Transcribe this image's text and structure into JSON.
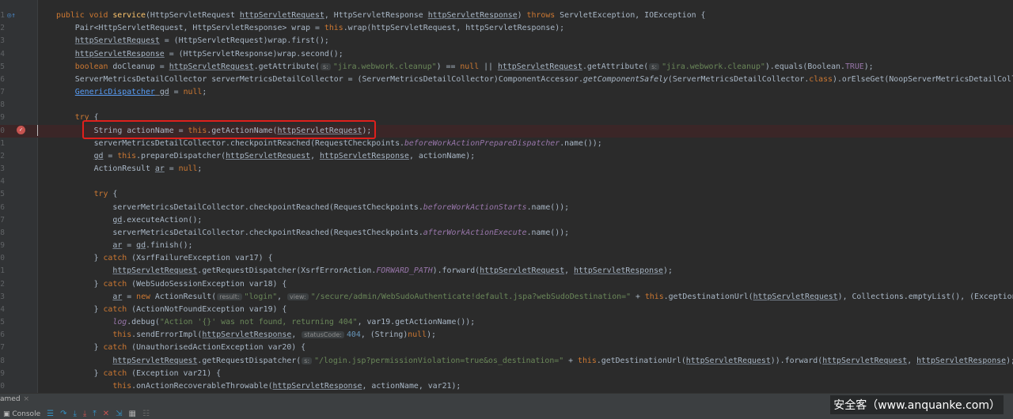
{
  "code": {
    "lines": [
      {
        "num": "1",
        "indent": 0,
        "t": [
          [
            "kw",
            "public void "
          ],
          [
            "m",
            "service"
          ],
          [
            "",
            "(HttpServletRequest "
          ],
          [
            "u",
            "httpServletRequest"
          ],
          [
            "",
            ", HttpServletResponse "
          ],
          [
            "u",
            "httpServletResponse"
          ],
          [
            "",
            ") "
          ],
          [
            "kw",
            "throws "
          ],
          [
            "",
            "ServletException, IOException {"
          ]
        ]
      },
      {
        "num": "2",
        "indent": 1,
        "t": [
          [
            "",
            "Pair<HttpServletRequest, HttpServletResponse> wrap = "
          ],
          [
            "kw",
            "this"
          ],
          [
            "",
            ".wrap(httpServletRequest, httpServletResponse);"
          ]
        ]
      },
      {
        "num": "3",
        "indent": 1,
        "t": [
          [
            "u",
            "httpServletRequest"
          ],
          [
            "",
            " = (HttpServletRequest)wrap.first();"
          ]
        ]
      },
      {
        "num": "4",
        "indent": 1,
        "t": [
          [
            "u",
            "httpServletResponse"
          ],
          [
            "",
            " = (HttpServletResponse)wrap.second();"
          ]
        ]
      },
      {
        "num": "5",
        "indent": 1,
        "t": [
          [
            "kw",
            "boolean "
          ],
          [
            "",
            "doCleanup = "
          ],
          [
            "u",
            "httpServletRequest"
          ],
          [
            "",
            ".getAttribute("
          ],
          [
            "h",
            "s:"
          ],
          [
            "s",
            "\"jira.webwork.cleanup\""
          ],
          [
            "",
            ") == "
          ],
          [
            "kw",
            "null "
          ],
          [
            "",
            "|| "
          ],
          [
            "u",
            "httpServletRequest"
          ],
          [
            "",
            ".getAttribute("
          ],
          [
            "h",
            "s:"
          ],
          [
            "s",
            "\"jira.webwork.cleanup\""
          ],
          [
            "",
            ").equals(Boolean."
          ],
          [
            "f",
            "TRUE"
          ],
          [
            "",
            ");"
          ]
        ]
      },
      {
        "num": "6",
        "indent": 1,
        "t": [
          [
            "",
            "ServerMetricsDetailCollector serverMetricsDetailCollector = (ServerMetricsDetailCollector)ComponentAccessor."
          ],
          [
            "it",
            "getComponentSafely"
          ],
          [
            "",
            "(ServerMetricsDetailCollector."
          ],
          [
            "kw",
            "class"
          ],
          [
            "",
            ").orElseGet(NoopServerMetricsDetailCollec"
          ]
        ]
      },
      {
        "num": "7",
        "indent": 1,
        "t": [
          [
            "cls",
            "GenericDispatcher"
          ],
          [
            "",
            ""
          ],
          [
            "u",
            " gd"
          ],
          [
            "",
            " = "
          ],
          [
            "kw",
            "null"
          ],
          [
            "",
            ";"
          ]
        ]
      },
      {
        "num": "8",
        "indent": 0,
        "t": []
      },
      {
        "num": "9",
        "indent": 1,
        "t": [
          [
            "kw",
            "try "
          ],
          [
            "",
            "{"
          ]
        ]
      },
      {
        "num": "0",
        "indent": 2,
        "hl": true,
        "t": [
          [
            "",
            "String actionName = "
          ],
          [
            "kw",
            "this"
          ],
          [
            "",
            ".getActionName("
          ],
          [
            "u",
            "httpServletRequest"
          ],
          [
            "",
            ");"
          ]
        ]
      },
      {
        "num": "1",
        "indent": 2,
        "t": [
          [
            "",
            "serverMetricsDetailCollector.checkpointReached(RequestCheckpoints."
          ],
          [
            "fi",
            "beforeWorkActionPrepareDispatcher"
          ],
          [
            "",
            ".name());"
          ]
        ]
      },
      {
        "num": "2",
        "indent": 2,
        "t": [
          [
            "u",
            "gd"
          ],
          [
            "",
            " = "
          ],
          [
            "kw",
            "this"
          ],
          [
            "",
            ".prepareDispatcher("
          ],
          [
            "u",
            "httpServletRequest"
          ],
          [
            "",
            ", "
          ],
          [
            "u",
            "httpServletResponse"
          ],
          [
            "",
            ", actionName);"
          ]
        ]
      },
      {
        "num": "3",
        "indent": 2,
        "t": [
          [
            "",
            "ActionResult "
          ],
          [
            "u",
            "ar"
          ],
          [
            "",
            " = "
          ],
          [
            "kw",
            "null"
          ],
          [
            "",
            ";"
          ]
        ]
      },
      {
        "num": "4",
        "indent": 0,
        "t": []
      },
      {
        "num": "5",
        "indent": 2,
        "t": [
          [
            "kw",
            "try "
          ],
          [
            "",
            "{"
          ]
        ]
      },
      {
        "num": "6",
        "indent": 3,
        "t": [
          [
            "",
            "serverMetricsDetailCollector.checkpointReached(RequestCheckpoints."
          ],
          [
            "fi",
            "beforeWorkActionStarts"
          ],
          [
            "",
            ".name());"
          ]
        ]
      },
      {
        "num": "7",
        "indent": 3,
        "t": [
          [
            "u",
            "gd"
          ],
          [
            "",
            ".executeAction();"
          ]
        ]
      },
      {
        "num": "8",
        "indent": 3,
        "t": [
          [
            "",
            "serverMetricsDetailCollector.checkpointReached(RequestCheckpoints."
          ],
          [
            "fi",
            "afterWorkActionExecute"
          ],
          [
            "",
            ".name());"
          ]
        ]
      },
      {
        "num": "9",
        "indent": 3,
        "t": [
          [
            "u",
            "ar"
          ],
          [
            "",
            " = "
          ],
          [
            "u",
            "gd"
          ],
          [
            "",
            ".finish();"
          ]
        ]
      },
      {
        "num": "0",
        "indent": 2,
        "t": [
          [
            "",
            "} "
          ],
          [
            "kw",
            "catch "
          ],
          [
            "",
            "(XsrfFailureException var17) {"
          ]
        ]
      },
      {
        "num": "1",
        "indent": 3,
        "t": [
          [
            "u",
            "httpServletRequest"
          ],
          [
            "",
            ".getRequestDispatcher(XsrfErrorAction."
          ],
          [
            "fi",
            "FORWARD_PATH"
          ],
          [
            "",
            ").forward("
          ],
          [
            "u",
            "httpServletRequest"
          ],
          [
            "",
            ", "
          ],
          [
            "u",
            "httpServletResponse"
          ],
          [
            "",
            ");"
          ]
        ]
      },
      {
        "num": "2",
        "indent": 2,
        "t": [
          [
            "",
            "} "
          ],
          [
            "kw",
            "catch "
          ],
          [
            "",
            "(WebSudoSessionException var18) {"
          ]
        ]
      },
      {
        "num": "3",
        "indent": 3,
        "t": [
          [
            "u",
            "ar"
          ],
          [
            "",
            " = "
          ],
          [
            "kw",
            "new "
          ],
          [
            "",
            "ActionResult("
          ],
          [
            "h",
            "result:"
          ],
          [
            "s",
            "\"login\""
          ],
          [
            "",
            ", "
          ],
          [
            "h",
            "view:"
          ],
          [
            "s",
            "\"/secure/admin/WebSudoAuthenticate!default.jspa?webSudoDestination=\""
          ],
          [
            "",
            " + "
          ],
          [
            "kw",
            "this"
          ],
          [
            "",
            ".getDestinationUrl("
          ],
          [
            "u",
            "httpServletRequest"
          ],
          [
            "",
            "), Collections.emptyList(), (Exception)"
          ]
        ]
      },
      {
        "num": "4",
        "indent": 2,
        "t": [
          [
            "",
            "} "
          ],
          [
            "kw",
            "catch "
          ],
          [
            "",
            "(ActionNotFoundException var19) {"
          ]
        ]
      },
      {
        "num": "5",
        "indent": 3,
        "t": [
          [
            "fi",
            "log"
          ],
          [
            "",
            ".debug("
          ],
          [
            "s",
            "\"Action '{}' was not found, returning 404\""
          ],
          [
            "",
            ", var19.getActionName());"
          ]
        ]
      },
      {
        "num": "6",
        "indent": 3,
        "t": [
          [
            "kw",
            "this"
          ],
          [
            "",
            ".sendErrorImpl("
          ],
          [
            "u",
            "httpServletResponse"
          ],
          [
            "",
            ", "
          ],
          [
            "h",
            "statusCode:"
          ],
          [
            "n",
            "404"
          ],
          [
            "",
            ", (String)"
          ],
          [
            "kw",
            "null"
          ],
          [
            "",
            ");"
          ]
        ]
      },
      {
        "num": "7",
        "indent": 2,
        "t": [
          [
            "",
            "} "
          ],
          [
            "kw",
            "catch "
          ],
          [
            "",
            "(UnauthorisedActionException var20) {"
          ]
        ]
      },
      {
        "num": "8",
        "indent": 3,
        "t": [
          [
            "u",
            "httpServletRequest"
          ],
          [
            "",
            ".getRequestDispatcher("
          ],
          [
            "h",
            "s:"
          ],
          [
            "s",
            "\"/login.jsp?permissionViolation=true&os_destination=\""
          ],
          [
            "",
            " + "
          ],
          [
            "kw",
            "this"
          ],
          [
            "",
            ".getDestinationUrl("
          ],
          [
            "u",
            "httpServletRequest"
          ],
          [
            "",
            ")).forward("
          ],
          [
            "u",
            "httpServletRequest"
          ],
          [
            "",
            ", "
          ],
          [
            "u",
            "httpServletResponse"
          ],
          [
            "",
            ");"
          ]
        ]
      },
      {
        "num": "9",
        "indent": 2,
        "t": [
          [
            "",
            "} "
          ],
          [
            "kw",
            "catch "
          ],
          [
            "",
            "(Exception var21) {"
          ]
        ]
      },
      {
        "num": "0",
        "indent": 3,
        "t": [
          [
            "kw",
            "this"
          ],
          [
            "",
            ".onActionRecoverableThrowable("
          ],
          [
            "u",
            "httpServletResponse"
          ],
          [
            "",
            ", actionName, var21);"
          ]
        ]
      }
    ]
  },
  "bottom": {
    "tab_label": "amed",
    "tab_close": "×",
    "console_label": "Console"
  },
  "watermark": "安全客（www.anquanke.com）"
}
